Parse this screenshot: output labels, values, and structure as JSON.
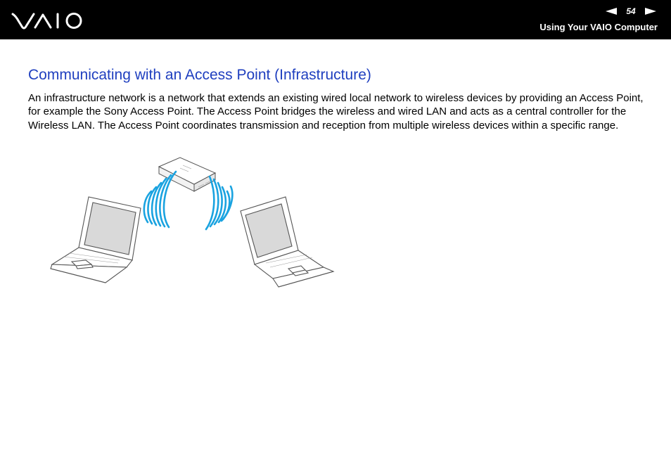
{
  "header": {
    "logo_text": "VAIO",
    "page_number": "54",
    "prev_icon": "left-arrow-icon",
    "next_icon": "right-arrow-icon",
    "section_title": "Using Your VAIO Computer"
  },
  "content": {
    "heading": "Communicating with an Access Point (Infrastructure)",
    "paragraph": "An infrastructure network is a network that extends an existing wired local network to wireless devices by providing an Access Point, for example the Sony Access Point. The Access Point bridges the wireless and wired LAN and acts as a central controller for the Wireless LAN. The Access Point coordinates transmission and reception from multiple wireless devices within a specific range."
  },
  "colors": {
    "header_bg": "#000000",
    "heading": "#1f3fbf",
    "signal": "#1aa3e0"
  }
}
